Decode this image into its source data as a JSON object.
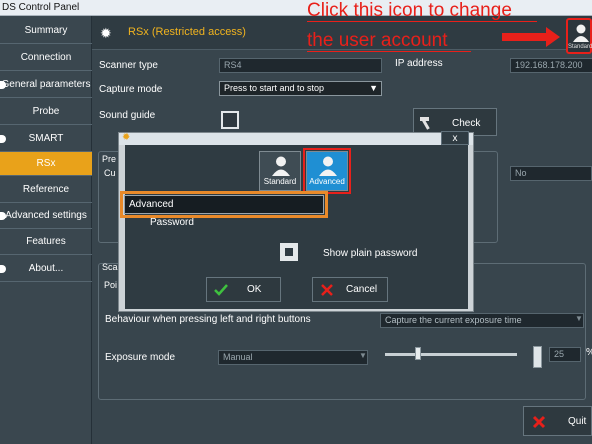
{
  "window": {
    "title": "DS Control Panel"
  },
  "sidebar": {
    "items": [
      {
        "label": "Summary",
        "dot": false
      },
      {
        "label": "Connection",
        "dot": false
      },
      {
        "label": "General parameters",
        "dot": true
      },
      {
        "label": "Probe",
        "dot": false
      },
      {
        "label": "SMART",
        "dot": true
      },
      {
        "label": "RSx",
        "dot": false
      },
      {
        "label": "Reference",
        "dot": false
      },
      {
        "label": "Advanced settings",
        "dot": true
      },
      {
        "label": "Features",
        "dot": false
      },
      {
        "label": "About...",
        "dot": true
      }
    ],
    "active_index": 5
  },
  "header": {
    "title": "RSx (Restricted access)",
    "user_label": "Standard"
  },
  "annotation": {
    "line1": "Click this icon to change",
    "line2": "the user account"
  },
  "form": {
    "scanner_type_label": "Scanner type",
    "scanner_type_value": "RS4",
    "ip_label": "IP address",
    "ip_value": "192.168.178.200",
    "capture_mode_label": "Capture mode",
    "capture_mode_value": "Press to start and to stop",
    "sound_guide_label": "Sound guide",
    "check_label": "Check",
    "pre_group_label": "Pre",
    "pre_row_label": "Cu",
    "no_value": "No",
    "sca_group_label": "Sca",
    "poi_label": "Poi",
    "behaviour_label": "Behaviour when pressing left and right buttons",
    "behaviour_value": "Capture the current exposure time",
    "exposure_mode_label": "Exposure mode",
    "exposure_mode_value": "Manual",
    "exposure_value": "25",
    "exposure_unit": "%",
    "quit_label": "Quit"
  },
  "dialog": {
    "close_label": "x",
    "standard_label": "Standard",
    "advanced_label": "Advanced",
    "selected": "Advanced",
    "password_label": "Password",
    "password_value": "Advanced",
    "show_plain_label": "Show plain password",
    "ok_label": "OK",
    "cancel_label": "Cancel"
  },
  "colors": {
    "accent": "#e9a21a",
    "annotation": "#e8201a",
    "selected_account": "#1f8fd3"
  }
}
